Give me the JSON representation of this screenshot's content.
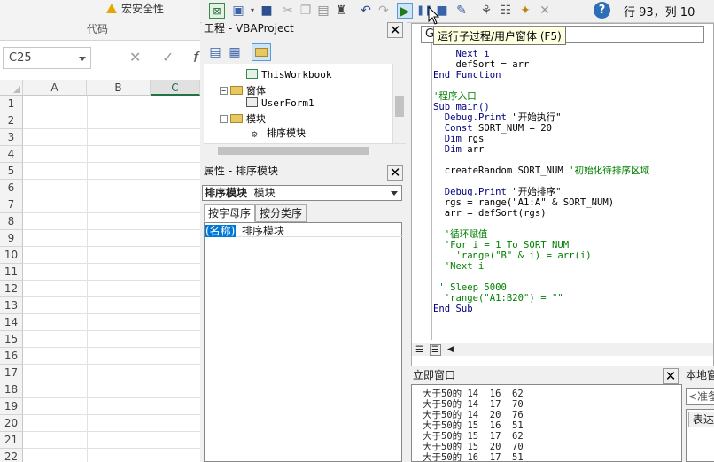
{
  "excel": {
    "security_warning": "宏安全性",
    "group_label": "代码",
    "name_box": "C25",
    "formula_cancel": "✕",
    "formula_confirm": "✓",
    "formula_fx": "f",
    "columns": [
      "A",
      "B",
      "C"
    ],
    "rows": [
      "1",
      "2",
      "3",
      "4",
      "5",
      "6",
      "7",
      "8",
      "9",
      "10",
      "11",
      "12",
      "13",
      "14",
      "15",
      "16",
      "17",
      "18",
      "19",
      "20",
      "21",
      "22"
    ]
  },
  "toolbar": {
    "position": "行 93，列 10",
    "run_tooltip": "运行子过程/用户窗体 (F5)"
  },
  "project": {
    "title": "工程 - VBAProject",
    "items": {
      "thisworkbook": "ThisWorkbook",
      "forms_folder": "窗体",
      "userform": "UserForm1",
      "modules_folder": "模块",
      "module": "排序模块"
    }
  },
  "properties": {
    "title": "属性 - 排序模块",
    "object_name": "排序模块",
    "object_type": "模块",
    "tab_alpha": "按字母序",
    "tab_category": "按分类序",
    "prop_name": "(名称)",
    "prop_value": "排序模块"
  },
  "code": {
    "header_char": "G",
    "lines": [
      {
        "indent": "    ",
        "parts": [
          {
            "t": "Next i",
            "c": "kw"
          }
        ]
      },
      {
        "indent": "    ",
        "parts": [
          {
            "t": "defSort = arr",
            "c": "tx"
          }
        ]
      },
      {
        "indent": "",
        "parts": [
          {
            "t": "End Function",
            "c": "kw"
          }
        ]
      },
      {
        "indent": "",
        "parts": []
      },
      {
        "indent": "",
        "parts": [
          {
            "t": "'程序入口",
            "c": "cm"
          }
        ]
      },
      {
        "indent": "",
        "parts": [
          {
            "t": "Sub main()",
            "c": "kw"
          }
        ]
      },
      {
        "indent": "  ",
        "parts": [
          {
            "t": "Debug.Print ",
            "c": "kw"
          },
          {
            "t": "\"开始执行\"",
            "c": "tx"
          }
        ]
      },
      {
        "indent": "  ",
        "parts": [
          {
            "t": "Const ",
            "c": "kw"
          },
          {
            "t": "SORT_NUM = 20",
            "c": "tx"
          }
        ]
      },
      {
        "indent": "  ",
        "parts": [
          {
            "t": "Dim ",
            "c": "kw"
          },
          {
            "t": "rgs",
            "c": "tx"
          }
        ]
      },
      {
        "indent": "  ",
        "parts": [
          {
            "t": "Dim ",
            "c": "kw"
          },
          {
            "t": "arr",
            "c": "tx"
          }
        ]
      },
      {
        "indent": "",
        "parts": []
      },
      {
        "indent": "  ",
        "parts": [
          {
            "t": "createRandom SORT_NUM ",
            "c": "tx"
          },
          {
            "t": "'初始化待排序区域",
            "c": "cm"
          }
        ]
      },
      {
        "indent": "",
        "parts": []
      },
      {
        "indent": "  ",
        "parts": [
          {
            "t": "Debug.Print ",
            "c": "kw"
          },
          {
            "t": "\"开始排序\"",
            "c": "tx"
          }
        ]
      },
      {
        "indent": "  ",
        "parts": [
          {
            "t": "rgs = range(\"A1:A\" & SORT_NUM)",
            "c": "tx"
          }
        ]
      },
      {
        "indent": "  ",
        "parts": [
          {
            "t": "arr = defSort(rgs)",
            "c": "tx"
          }
        ]
      },
      {
        "indent": "",
        "parts": []
      },
      {
        "indent": "  ",
        "parts": [
          {
            "t": "'循环赋值",
            "c": "cm"
          }
        ]
      },
      {
        "indent": "  ",
        "parts": [
          {
            "t": "'For i = 1 To SORT_NUM",
            "c": "cm"
          }
        ]
      },
      {
        "indent": "    ",
        "parts": [
          {
            "t": "'range(\"B\" & i) = arr(i)",
            "c": "cm"
          }
        ]
      },
      {
        "indent": "  ",
        "parts": [
          {
            "t": "'Next i",
            "c": "cm"
          }
        ]
      },
      {
        "indent": "",
        "parts": []
      },
      {
        "indent": " ",
        "parts": [
          {
            "t": "' Sleep 5000",
            "c": "cm"
          }
        ]
      },
      {
        "indent": "  ",
        "parts": [
          {
            "t": "'range(\"A1:B20\") = \"\"",
            "c": "cm"
          }
        ]
      },
      {
        "indent": "",
        "parts": [
          {
            "t": "End Sub",
            "c": "kw"
          }
        ]
      }
    ]
  },
  "immediate": {
    "title": "立即窗口",
    "lines": [
      "大于50的 14  16  62",
      "大于50的 14  17  70",
      "大于50的 14  20  76",
      "大于50的 15  16  51",
      "大于50的 15  17  62",
      "大于50的 15  20  70",
      "大于50的 16  17  51"
    ]
  },
  "locals": {
    "title": "本地窗",
    "ready": "<准备",
    "expr_header": "表达"
  }
}
